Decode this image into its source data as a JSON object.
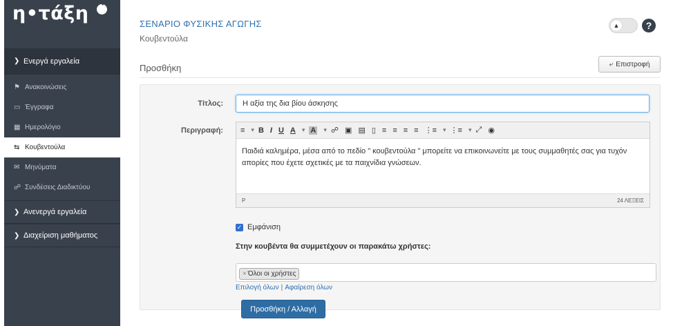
{
  "sidebar": {
    "logo": "η•τάξη",
    "groups": [
      {
        "label": "Ενεργά εργαλεία"
      },
      {
        "label": "Ανενεργά εργαλεία"
      },
      {
        "label": "Διαχείριση μαθήματος"
      }
    ],
    "items": [
      {
        "label": "Ανακοινώσεις",
        "icon": "bullhorn-icon"
      },
      {
        "label": "Έγγραφα",
        "icon": "folder-icon"
      },
      {
        "label": "Ημερολόγιο",
        "icon": "calendar-icon"
      },
      {
        "label": "Κουβεντούλα",
        "icon": "exchange-icon"
      },
      {
        "label": "Μηνύματα",
        "icon": "envelope-icon"
      },
      {
        "label": "Συνδέσεις Διαδικτύου",
        "icon": "link-icon"
      }
    ]
  },
  "header": {
    "course_title": "ΣΕΝΑΡΙΟ ΦΥΣΙΚΗΣ ΑΓΩΓΗΣ",
    "course_subtitle": "Κουβεντούλα",
    "help": "?"
  },
  "section": {
    "title": "Προσθήκη",
    "back_label": "Επιστροφή"
  },
  "form": {
    "title_label": "Τίτλος:",
    "title_value": "Η αξία της δια βίου άσκησης",
    "description_label": "Περιγραφή:",
    "description_text": "Παιδιά καλημέρα, μέσα από το πεδίο  \" κουβεντούλα \"  μπορείτε να επικοινωνείτε με τους συμμαθητές σας για τυχόν απορίες που έχετε σχετικές με τα παιχνίδια γνώσεων.",
    "editor_path": "P",
    "word_count": "24 ΛΕΞΕΙΣ",
    "toolbar": [
      "≡",
      "B",
      "I",
      "U",
      "A",
      "A"
    ],
    "show_label": "Εμφάνιση",
    "users_label": "Στην κουβέντα θα συμμετέχουν οι παρακάτω χρήστες:",
    "users_tag": "Όλοι οι χρήστες",
    "select_all": "Επιλογή όλων",
    "remove_all": "Αφαίρεση όλων",
    "submit_label": "Προσθήκη / Αλλαγή"
  },
  "colors": {
    "sidebar_bg": "#39414c",
    "link": "#2f6fb0",
    "primary_button": "#2e6da4"
  }
}
